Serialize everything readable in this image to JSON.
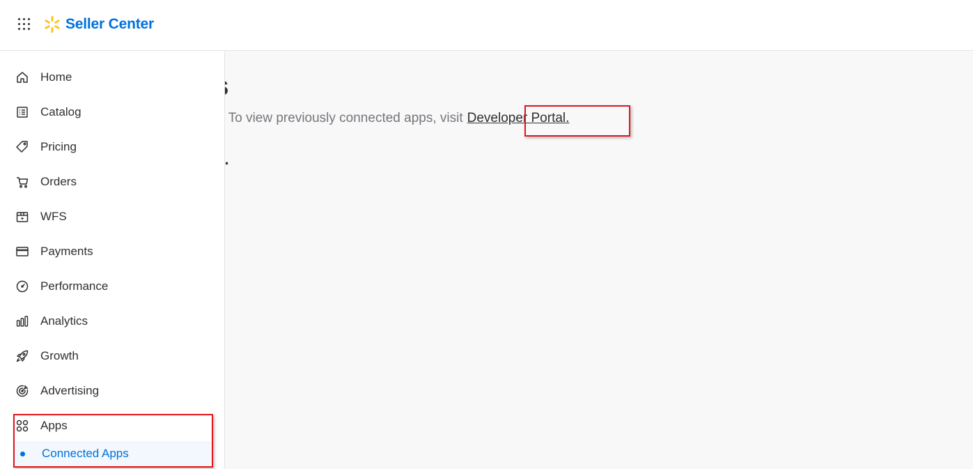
{
  "header": {
    "brand_name": "Seller Center",
    "brand_color": "#0071dc",
    "spark_color": "#ffc220",
    "app_switcher_icon": "grid-dots-icon"
  },
  "sidebar": {
    "items": [
      {
        "label": "Home",
        "icon": "home-icon"
      },
      {
        "label": "Catalog",
        "icon": "catalog-list-icon"
      },
      {
        "label": "Pricing",
        "icon": "price-tag-icon"
      },
      {
        "label": "Orders",
        "icon": "cart-icon"
      },
      {
        "label": "WFS",
        "icon": "box-icon"
      },
      {
        "label": "Payments",
        "icon": "credit-card-icon"
      },
      {
        "label": "Performance",
        "icon": "gauge-icon"
      },
      {
        "label": "Analytics",
        "icon": "bar-chart-icon"
      },
      {
        "label": "Growth",
        "icon": "rocket-icon"
      },
      {
        "label": "Advertising",
        "icon": "target-icon"
      },
      {
        "label": "Apps",
        "icon": "apps-grid-icon"
      }
    ],
    "sub_items": [
      {
        "label": "Connected Apps",
        "active": true
      }
    ],
    "active_color": "#0071dc"
  },
  "main": {
    "title_partial": "pps",
    "description": "apps here. To view previously connected apps, visit",
    "developer_portal_link": "Developer Portal.",
    "empty_message_partial": "d."
  },
  "annotations": {
    "highlight_color": "#e3131b"
  }
}
